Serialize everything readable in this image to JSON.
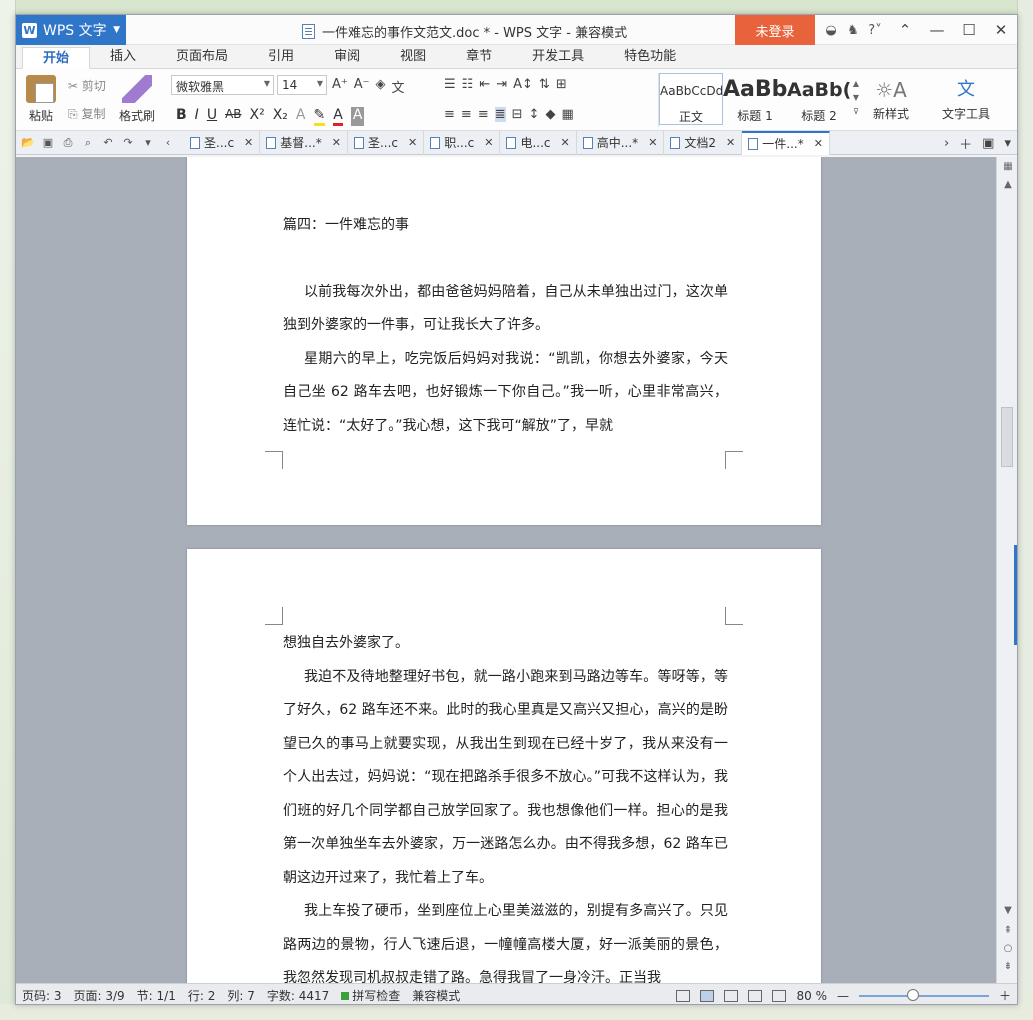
{
  "app": {
    "name": "WPS 文字",
    "doc_title": "一件难忘的事作文范文.doc * - WPS 文字 - 兼容模式",
    "login": "未登录"
  },
  "ribbon_tabs": [
    "开始",
    "插入",
    "页面布局",
    "引用",
    "审阅",
    "视图",
    "章节",
    "开发工具",
    "特色功能"
  ],
  "toolbar": {
    "paste": "粘贴",
    "cut": "剪切",
    "copy": "复制",
    "format_painter": "格式刷",
    "font_name": "微软雅黑",
    "font_size": "14",
    "styles": [
      {
        "sample": "AaBbCcDd",
        "name": "正文"
      },
      {
        "sample": "AaBb",
        "name": "标题 1"
      },
      {
        "sample": "AaBb(",
        "name": "标题 2"
      }
    ],
    "new_style": "新样式",
    "text_tools": "文字工具"
  },
  "doc_tabs": [
    {
      "label": "圣...c",
      "active": false
    },
    {
      "label": "基督...*",
      "active": false
    },
    {
      "label": "圣...c",
      "active": false
    },
    {
      "label": "职...c",
      "active": false
    },
    {
      "label": "电...c",
      "active": false
    },
    {
      "label": "高中...*",
      "active": false
    },
    {
      "label": "文档2",
      "active": false
    },
    {
      "label": "一件...*",
      "active": true
    }
  ],
  "page1": {
    "heading": "篇四：一件难忘的事",
    "paragraphs": [
      "以前我每次外出，都由爸爸妈妈陪着，自己从未单独出过门，这次单独到外婆家的一件事，可让我长大了许多。",
      "星期六的早上，吃完饭后妈妈对我说：“凯凯，你想去外婆家，今天自己坐 62 路车去吧，也好锻炼一下你自己。”我一听，心里非常高兴，连忙说：“太好了。”我心想，这下我可“解放”了，早就"
    ]
  },
  "page2": {
    "first_line": "想独自去外婆家了。",
    "paragraphs": [
      "我迫不及待地整理好书包，就一路小跑来到马路边等车。等呀等，等了好久，62 路车还不来。此时的我心里真是又高兴又担心，高兴的是盼望已久的事马上就要实现，从我出生到现在已经十岁了，我从来没有一个人出去过，妈妈说：“现在把路杀手很多不放心。”可我不这样认为，我们班的好几个同学都自己放学回家了。我也想像他们一样。担心的是我第一次单独坐车去外婆家，万一迷路怎么办。由不得我多想，62 路车已朝这边开过来了，我忙着上了车。",
      "我上车投了硬币，坐到座位上心里美滋滋的，别提有多高兴了。只见路两边的景物，行人飞速后退，一幢幢高楼大厦，好一派美丽的景色，我忽然发现司机叔叔走错了路。急得我冒了一身冷汗。正当我"
    ]
  },
  "status": {
    "page_code": "页码: 3",
    "pages": "页面: 3/9",
    "section": "节: 1/1",
    "row": "行: 2",
    "col": "列: 7",
    "word_count": "字数: 4417",
    "spell_check": "拼写检查",
    "compat": "兼容模式",
    "zoom": "80 %"
  }
}
